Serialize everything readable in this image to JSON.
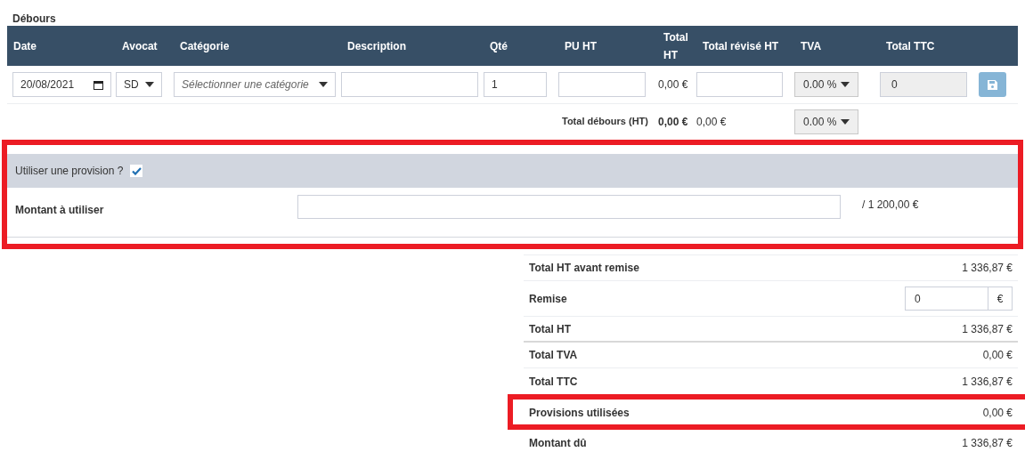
{
  "section_title": "Débours",
  "table": {
    "columns": [
      "Date",
      "Avocat",
      "Catégorie",
      "Description",
      "Qté",
      "PU HT",
      "Total HT",
      "Total révisé HT",
      "TVA",
      "Total TTC"
    ],
    "row": {
      "date": "20/08/2021",
      "avocat": "SD",
      "categorie_placeholder": "Sélectionner une catégorie",
      "qte": "1",
      "total_ht": "0,00 €",
      "tva": "0.00 %",
      "total_ttc": "0"
    },
    "footer": {
      "label": "Total débours (HT)",
      "total_ht": "0,00 €",
      "total_revise": "0,00 €",
      "tva": "0.00 %"
    }
  },
  "provision": {
    "label": "Utiliser une provision ?",
    "checked": true,
    "amount_label": "Montant à utiliser",
    "amount_of": "/ 1 200,00 €",
    "highlighted": true
  },
  "totals": [
    {
      "kind": "text",
      "label": "Total HT avant remise",
      "value": "1 336,87 €",
      "highlighted": false
    },
    {
      "kind": "input",
      "label": "Remise",
      "value": "0",
      "unit": "€",
      "highlighted": false
    },
    {
      "kind": "text",
      "label": "Total HT",
      "value": "1 336,87 €",
      "highlighted": false
    },
    {
      "kind": "text",
      "label": "Total TVA",
      "value": "0,00 €",
      "highlighted": false
    },
    {
      "kind": "text",
      "label": "Total TTC",
      "value": "1 336,87 €",
      "highlighted": false
    },
    {
      "kind": "text",
      "label": "Provisions utilisées",
      "value": "0,00 €",
      "highlighted": true
    },
    {
      "kind": "text",
      "label": "Montant dû",
      "value": "1 336,87 €",
      "highlighted": false
    }
  ]
}
